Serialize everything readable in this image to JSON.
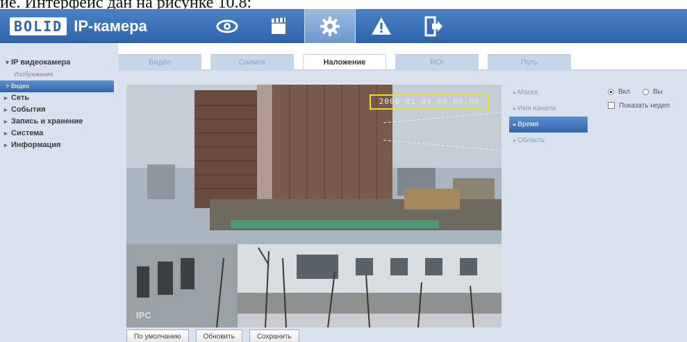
{
  "caption": "ие. Интерфейс дан на рисунке 10.8:",
  "header": {
    "logo_box": "BOLID",
    "logo_text": "IP-камера",
    "nav": [
      {
        "icon": "eye-icon",
        "active": false
      },
      {
        "icon": "clapperboard-icon",
        "active": false
      },
      {
        "icon": "gear-icon",
        "active": true
      },
      {
        "icon": "warning-icon",
        "active": false
      },
      {
        "icon": "exit-icon",
        "active": false
      }
    ]
  },
  "sidebar": {
    "group_title": "IP видеокамера",
    "sub_items": [
      "Изображение",
      "Видео"
    ],
    "active_sub": "Видео",
    "groups": [
      "Сеть",
      "События",
      "Запись и хранение",
      "Система",
      "Информация"
    ]
  },
  "tabs": [
    {
      "label": "Видео",
      "active": false
    },
    {
      "label": "Снимок",
      "active": false
    },
    {
      "label": "Наложение",
      "active": true
    },
    {
      "label": "ROI",
      "active": false
    },
    {
      "label": "Путь",
      "active": false
    }
  ],
  "video": {
    "time_text": "2000-01-01 00:00:00",
    "channel_text": "IPC"
  },
  "menu": {
    "items": [
      "Маска",
      "Имя канала",
      "Время",
      "Область"
    ],
    "active": "Время"
  },
  "options": {
    "radio_on_label": "Вкл",
    "radio_off_label": "Вы",
    "checkbox_label": "Показать недел"
  },
  "buttons": {
    "default": "По умолчанию",
    "refresh": "Обновить",
    "save": "Сохранить"
  },
  "colors": {
    "header": "#2c63ab",
    "sidebar_bg": "#d9e2ee",
    "accent": "#3565a8",
    "osd_border": "#e8e02a"
  }
}
